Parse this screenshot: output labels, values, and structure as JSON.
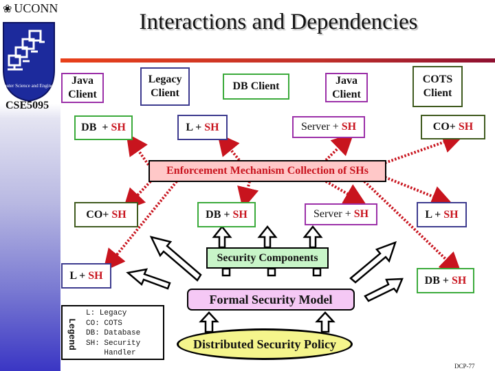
{
  "header": {
    "university": "UCONN",
    "course": "CSE5095",
    "logo_text": "Computer Science and Engineering",
    "title": "Interactions and Dependencies"
  },
  "colors": {
    "sh_red": "#c8141e",
    "enforcement_fill": "#ffc8c8",
    "security_components_fill": "#c8f5c8",
    "formal_model_fill": "#f5c8f5",
    "policy_fill": "#f5f58c",
    "java_border": "#9b2fa8",
    "legacy_border": "#3c3a8e",
    "db_border": "#3aaa3a",
    "cots_border": "#3f5a1e"
  },
  "clients": [
    {
      "label_line1": "Java",
      "label_line2": "Client"
    },
    {
      "label_line1": "Legacy",
      "label_line2": "Client"
    },
    {
      "label_line1": "DB Client",
      "label_line2": ""
    },
    {
      "label_line1": "Java",
      "label_line2": "Client"
    },
    {
      "label_line1": "COTS",
      "label_line2": "Client"
    }
  ],
  "handlers": [
    {
      "prefix": "DB  + ",
      "sh": "SH"
    },
    {
      "prefix": "L + ",
      "sh": "SH"
    },
    {
      "prefix": "Server + ",
      "sh": "SH"
    },
    {
      "prefix": "CO+ ",
      "sh": "SH"
    },
    {
      "prefix": "CO+ ",
      "sh": "SH"
    },
    {
      "prefix": "DB + ",
      "sh": "SH"
    },
    {
      "prefix": "Server + ",
      "sh": "SH"
    },
    {
      "prefix": "L + ",
      "sh": "SH"
    },
    {
      "prefix": "L + ",
      "sh": "SH"
    },
    {
      "prefix": "DB + ",
      "sh": "SH"
    }
  ],
  "enforcement": "Enforcement Mechanism Collection of SHs",
  "security_components": "Security Components",
  "formal_model": "Formal Security Model",
  "policy": "Distributed Security Policy",
  "legend": {
    "title": "Legend",
    "items": [
      "L: Legacy",
      "CO: COTS",
      "DB: Database",
      "SH: Security",
      "    Handler"
    ]
  },
  "footer": "DCP-77"
}
